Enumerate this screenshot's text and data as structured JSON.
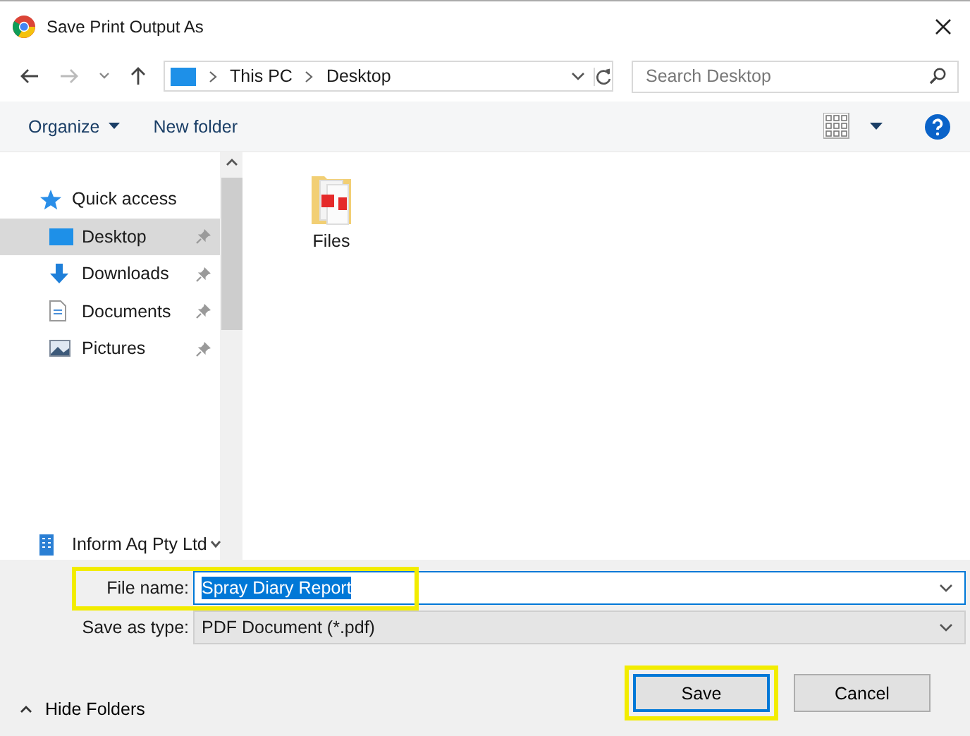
{
  "window": {
    "title": "Save Print Output As"
  },
  "navigation": {
    "breadcrumb": [
      "This PC",
      "Desktop"
    ],
    "search": {
      "placeholder": "Search Desktop"
    }
  },
  "toolbar": {
    "organize": "Organize",
    "new_folder": "New folder"
  },
  "sidebar": {
    "items": [
      {
        "label": "Quick access",
        "kind": "header",
        "selected": false
      },
      {
        "label": "Desktop",
        "kind": "pinned",
        "selected": true
      },
      {
        "label": "Downloads",
        "kind": "pinned",
        "selected": false
      },
      {
        "label": "Documents",
        "kind": "pinned",
        "selected": false
      },
      {
        "label": "Pictures",
        "kind": "pinned",
        "selected": false
      }
    ],
    "footer": "Inform Aq Pty Ltd"
  },
  "files": [
    {
      "name": "Files"
    }
  ],
  "form": {
    "file_name": {
      "label": "File name:",
      "value": "Spray Diary Report",
      "highlighted": true
    },
    "save_type": {
      "label": "Save as type:",
      "value": "PDF Document (*.pdf)"
    }
  },
  "hide_folders": "Hide Folders",
  "buttons": [
    {
      "label": "Save",
      "kind": "primary",
      "highlighted": true
    },
    {
      "label": "Cancel",
      "kind": "secondary",
      "highlighted": false
    }
  ]
}
